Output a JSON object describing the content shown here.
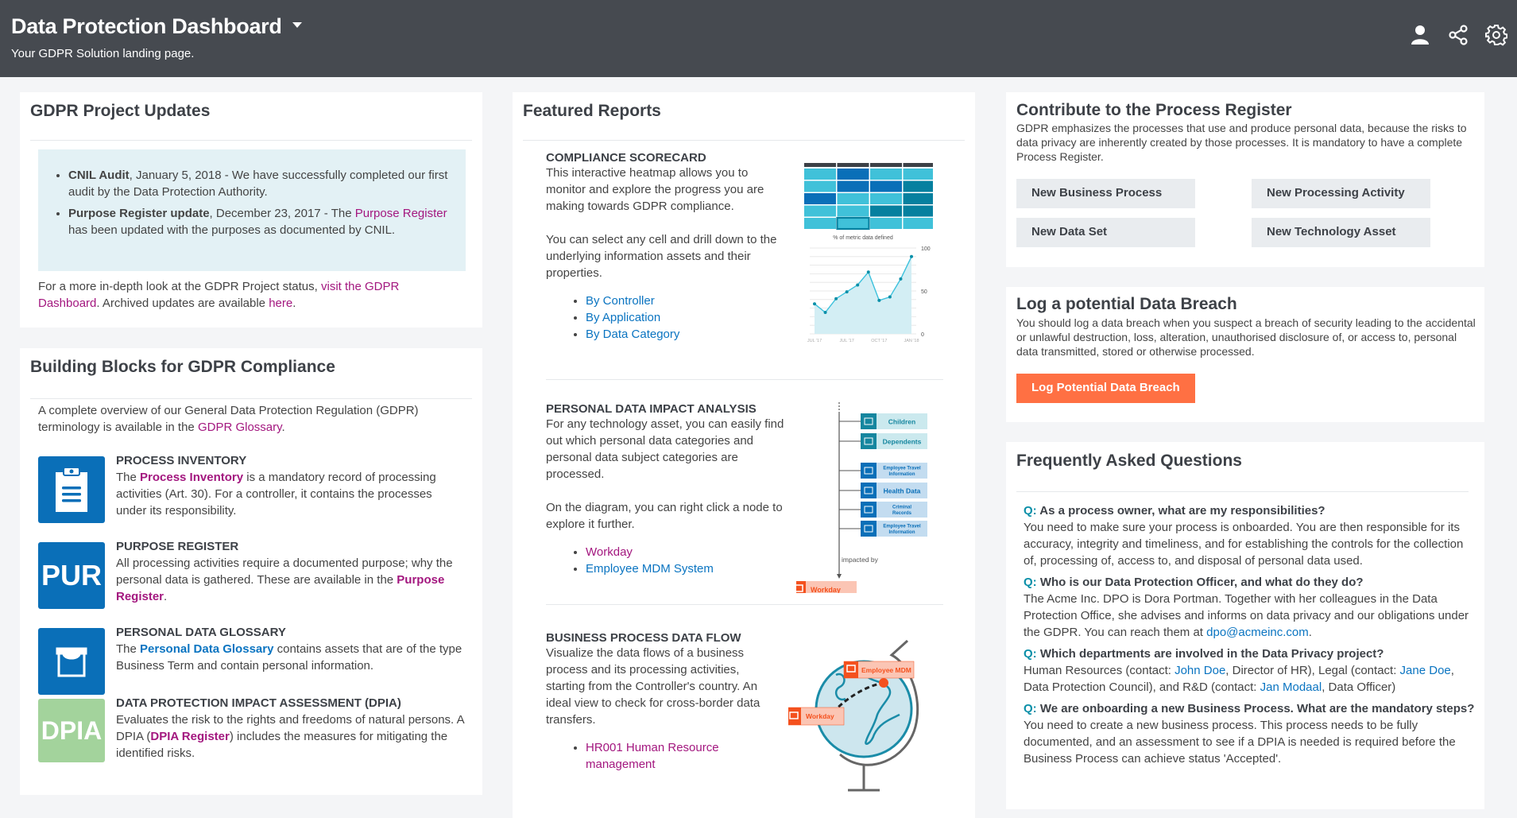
{
  "header": {
    "title": "Data Protection Dashboard",
    "subtitle": "Your GDPR Solution landing page.",
    "icons": [
      "user-icon",
      "share-icon",
      "gear-icon"
    ]
  },
  "updates": {
    "title": "GDPR Project Updates",
    "items": [
      {
        "bold": "CNIL Audit",
        "text": ", January 5, 2018 - We have successfully completed our first audit by the Data Protection Authority."
      },
      {
        "bold": "Purpose Register update",
        "text_before": ", December 23, 2017 - The ",
        "link": "Purpose Register",
        "text_after": " has been updated with the purposes as documented by CNIL."
      }
    ],
    "footer_before": "For a more in-depth look at the GDPR Project status, ",
    "footer_link1": "visit the GDPR Dashboard",
    "footer_mid": ". Archived updates are available ",
    "footer_link2": "here",
    "footer_after": "."
  },
  "blocks": {
    "title": "Building Blocks for GDPR Compliance",
    "intro_before": "A complete overview of our General Data Protection Regulation (GDPR) terminology is available in the ",
    "intro_link": "GDPR Glossary",
    "intro_after": ".",
    "items": [
      {
        "tile": "",
        "icon": "clipboard-icon",
        "tile_color": "#0a6fb8",
        "head": "PROCESS INVENTORY",
        "before": "The ",
        "link": "Process Inventory",
        "link_color": "magenta",
        "after": " is a mandatory record of processing activities (Art. 30). For a controller, it contains the processes under its responsibility."
      },
      {
        "tile": "PUR",
        "icon": "",
        "tile_color": "#0a6fb8",
        "head": "PURPOSE REGISTER",
        "before": "All processing activities require a documented purpose; why the personal data is gathered. These are available in the ",
        "link": "Purpose Register",
        "link_color": "magenta",
        "after": "."
      },
      {
        "tile": "",
        "icon": "glossary-icon",
        "tile_color": "#0a6fb8",
        "head": "PERSONAL DATA GLOSSARY",
        "before": "The ",
        "link": "Personal Data Glossary",
        "link_color": "blue",
        "after": " contains assets that are of the type Business Term and contain personal information."
      },
      {
        "tile": "DPIA",
        "icon": "",
        "tile_color": "#a3d39c",
        "head": "DATA PROTECTION IMPACT ASSESSMENT (DPIA)",
        "before": "Evaluates the risk to the rights and freedoms of natural persons. A DPIA (",
        "link": "DPIA Register",
        "link_color": "magenta",
        "after": ") includes the measures for mitigating the identified risks."
      }
    ]
  },
  "reports": {
    "title": "Featured Reports",
    "scorecard": {
      "head": "COMPLIANCE SCORECARD",
      "desc1": "This interactive heatmap allows you to monitor and explore the progress you are making towards GDPR compliance.",
      "desc2": "You can select any cell and drill down to the underlying information assets and their properties.",
      "links": [
        "By Controller",
        "By Application",
        "By Data Category"
      ],
      "heatmap": {
        "rows": [
          [
            "light",
            "dark",
            "light",
            "light"
          ],
          [
            "light",
            "dark",
            "dark",
            "teal"
          ],
          [
            "dark",
            "light",
            "light",
            "teal"
          ],
          [
            "light",
            "light",
            "teal",
            "teal"
          ],
          [
            "light",
            "selected",
            "light",
            "light"
          ]
        ],
        "colors": {
          "light": "#40c1d9",
          "dark": "#0a6fb8",
          "teal": "#06809f",
          "selected": "#40c1d9",
          "header": "#3d4147"
        }
      }
    },
    "impact": {
      "head": "PERSONAL DATA IMPACT ANALYSIS",
      "desc1": "For any technology asset, you can easily find out which personal data categories and personal data subject categories are processed.",
      "desc2": "On the diagram, you can right click a node to explore it further.",
      "links": [
        {
          "label": "Workday",
          "color": "magenta"
        },
        {
          "label": "Employee MDM System",
          "color": "blue"
        }
      ],
      "diagram": {
        "subject_nodes": [
          "Children",
          "Dependents"
        ],
        "category_nodes": [
          "Employee Travel Information",
          "Health Data",
          "Criminal Records",
          "Employee Travel Information"
        ],
        "edge_label": "impacted by",
        "source_node": "Workday"
      }
    },
    "flow": {
      "head": "BUSINESS PROCESS DATA FLOW",
      "desc": "Visualize the data flows of a business process and its processing activities, starting from the Controller's country. An ideal view to check for cross-border data transfers.",
      "links": [
        "HR001 Human Resource management"
      ],
      "globe": {
        "from": "Workday",
        "to": "Employee MDM"
      }
    }
  },
  "chart_data": {
    "type": "area",
    "title": "% of metric data defined",
    "x": [
      "JUL '17",
      "",
      "",
      "JUL '17",
      "",
      "",
      "OCT '17",
      "",
      "",
      "JAN '18"
    ],
    "xticks": [
      "JUL '17",
      "JUL '17",
      "OCT '17",
      "JAN '18"
    ],
    "series": [
      {
        "name": "% of metric data defined",
        "values": [
          35,
          25,
          41,
          49,
          57,
          72,
          39,
          43,
          64,
          90
        ]
      }
    ],
    "ylim": [
      0,
      100
    ],
    "yticks": [
      0,
      50,
      100
    ],
    "grid": true,
    "xlabel": "",
    "ylabel": ""
  },
  "contribute": {
    "title": "Contribute to the Process Register",
    "desc": "GDPR emphasizes the processes that use and produce personal data, because the risks to data privacy are inherently created by those processes. It is mandatory to have a complete Process Register.",
    "buttons": [
      "New Business Process",
      "New Processing Activity",
      "New Data Set",
      "New Technology Asset"
    ]
  },
  "breach": {
    "title": "Log a potential Data Breach",
    "desc": "You should log a data breach when you suspect a breach of security leading to the accidental or unlawful destruction, loss, alteration, unauthorised disclosure of, or access to, personal data transmitted, stored or otherwise processed.",
    "button": "Log Potential Data Breach",
    "button_color": "#ff7043"
  },
  "faq": {
    "title": "Frequently Asked Questions",
    "q_prefix": "Q:",
    "items": [
      {
        "q": "As a process owner, what are my responsibilities?",
        "a": [
          {
            "t": "You need to make sure your process is onboarded. You are then responsible for its accuracy, integrity and timeliness, and for establishing the controls for the collection of, processing of, access to, and disposal of personal data used."
          }
        ]
      },
      {
        "q": "Who is our Data Protection Officer, and what do they do?",
        "a": [
          {
            "t": "The Acme Inc. DPO is Dora Portman. Together with her colleagues in the Data Protection Office, she advises and informs on data privacy and our obligations under the GDPR. You can reach them at "
          },
          {
            "link": "dpo@acmeinc.com"
          },
          {
            "t": "."
          }
        ]
      },
      {
        "q": "Which departments are involved in the Data Privacy project?",
        "a": [
          {
            "t": "Human Resources (contact: "
          },
          {
            "link": "John Doe"
          },
          {
            "t": ", Director of HR), Legal (contact: "
          },
          {
            "link": "Jane Doe"
          },
          {
            "t": ", Data Protection Council), and R&D (contact: "
          },
          {
            "link": "Jan Modaal"
          },
          {
            "t": ", Data Officer)"
          }
        ]
      },
      {
        "q": "We are onboarding a new Business Process. What are the mandatory steps?",
        "a": [
          {
            "t": "You need to create a new business process. This process needs to be fully documented, and an assessment to see if a DPIA is needed is required before the Business Process can achieve status 'Accepted'."
          }
        ]
      }
    ]
  }
}
